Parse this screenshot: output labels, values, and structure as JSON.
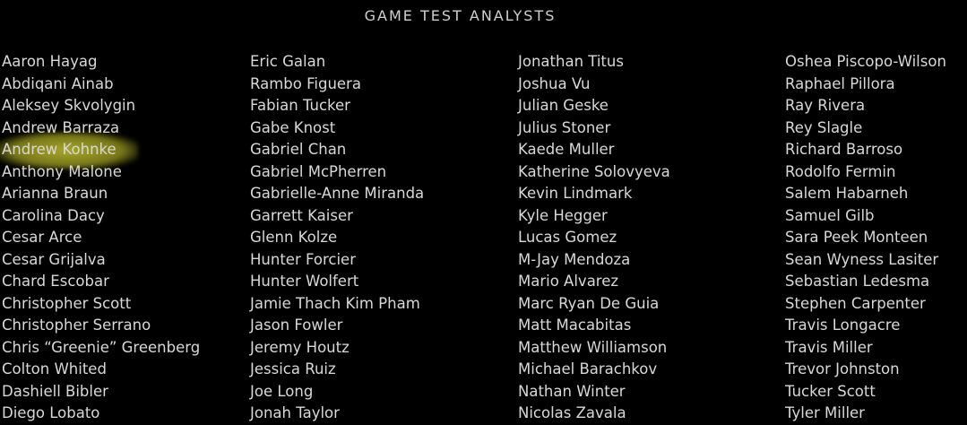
{
  "section_title": "GAME TEST ANALYSTS",
  "highlight_color": "#b8b830",
  "highlighted_name": "Andrew Kohnke",
  "columns": [
    [
      "Aaron Hayag",
      "Abdiqani Ainab",
      "Aleksey Skvolygin",
      "Andrew Barraza",
      "Andrew Kohnke",
      "Anthony Malone",
      "Arianna Braun",
      "Carolina Dacy",
      "Cesar Arce",
      "Cesar Grijalva",
      "Chard Escobar",
      "Christopher Scott",
      "Christopher Serrano",
      "Chris “Greenie” Greenberg",
      "Colton Whited",
      "Dashiell Bibler",
      "Diego Lobato"
    ],
    [
      "Eric Galan",
      "Rambo Figuera",
      "Fabian Tucker",
      "Gabe Knost",
      "Gabriel Chan",
      "Gabriel McPherren",
      "Gabrielle-Anne Miranda",
      "Garrett Kaiser",
      "Glenn Kolze",
      "Hunter Forcier",
      "Hunter Wolfert",
      "Jamie Thach Kim Pham",
      "Jason Fowler",
      "Jeremy Houtz",
      "Jessica Ruiz",
      "Joe Long",
      "Jonah Taylor"
    ],
    [
      "Jonathan Titus",
      "Joshua Vu",
      "Julian Geske",
      "Julius Stoner",
      "Kaede Muller",
      "Katherine Solovyeva",
      "Kevin Lindmark",
      "Kyle Hegger",
      "Lucas Gomez",
      "M-Jay Mendoza",
      "Mario Alvarez",
      "Marc Ryan De Guia",
      "Matt Macabitas",
      "Matthew Williamson",
      "Michael Barachkov",
      "Nathan Winter",
      "Nicolas Zavala"
    ],
    [
      "Oshea Piscopo-Wilson",
      "Raphael Pillora",
      "Ray Rivera",
      "Rey Slagle",
      "Richard Barroso",
      "Rodolfo Fermin",
      "Salem Habarneh",
      "Samuel Gilb",
      "Sara Peek Monteen",
      "Sean Wyness Lasiter",
      "Sebastian Ledesma",
      "Stephen Carpenter",
      "Travis Longacre",
      "Travis Miller",
      "Trevor Johnston",
      "Tucker Scott",
      "Tyler Miller"
    ]
  ]
}
